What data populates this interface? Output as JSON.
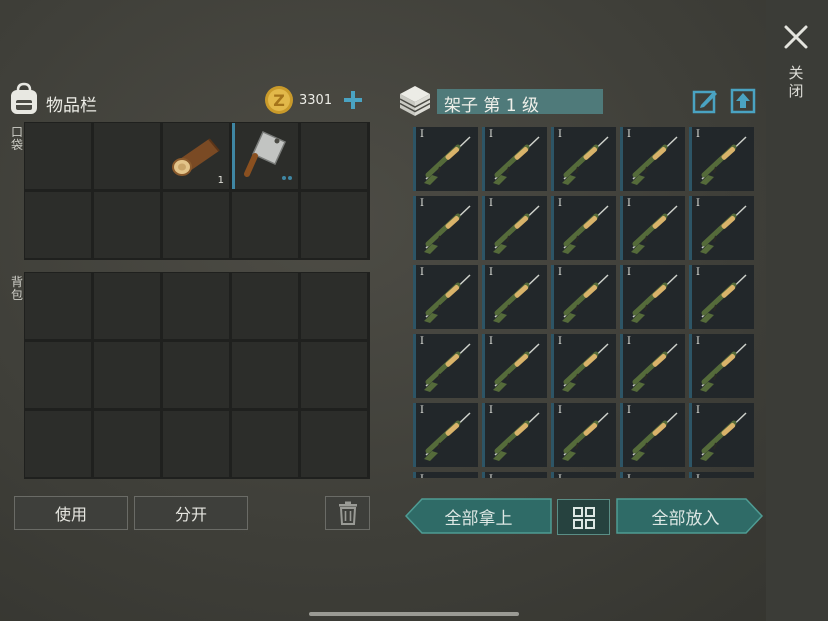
{
  "close": {
    "label": "关闭",
    "icon": "close-icon"
  },
  "inventory": {
    "title": "物品栏",
    "icon": "backpack-icon",
    "coins": {
      "icon": "coin-icon",
      "count": "3301",
      "add_icon": "plus-icon"
    },
    "pocket_label": "口袋",
    "backpack_label": "背包",
    "pocket_slots": [
      {
        "item": null
      },
      {
        "item": null
      },
      {
        "item": "log-icon",
        "quantity": "1"
      },
      {
        "item": "cleaver-icon",
        "selected": true,
        "durability_dots": 2
      },
      {
        "item": null
      },
      {
        "item": null
      },
      {
        "item": null
      },
      {
        "item": null
      },
      {
        "item": null
      },
      {
        "item": null
      }
    ],
    "backpack_slots": 15
  },
  "actions": {
    "use_label": "使用",
    "split_label": "分开",
    "delete_icon": "trash-icon"
  },
  "shelf": {
    "icon": "shelf-icon",
    "title": "架子 第 1 级",
    "rename_icon": "rename-icon",
    "upgrade_icon": "upgrade-icon",
    "item_icon": "sniper-rifle-icon",
    "tier": "I",
    "visible_rows": 5,
    "columns": 5,
    "take_all_label": "全部拿上",
    "put_all_label": "全部放入",
    "grid_toggle_icon": "grid-view-icon"
  },
  "colors": {
    "accent": "#3f86a3",
    "shelf_title_bg": "#4f7a7a",
    "arrow_button": "#2f6b67"
  }
}
